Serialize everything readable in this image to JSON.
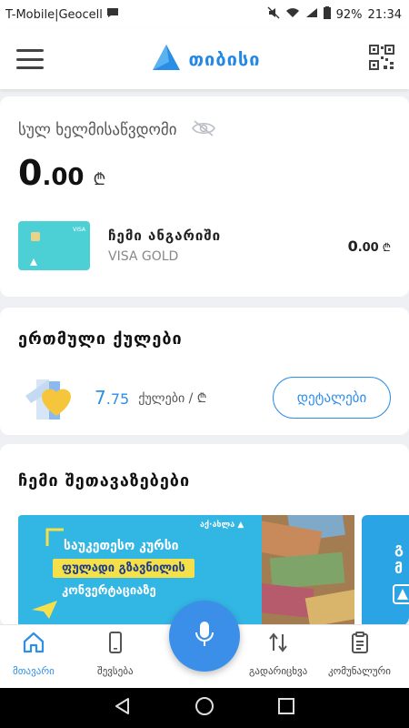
{
  "status_bar": {
    "carrier": "T-Mobile|Geocell",
    "battery": "92%",
    "time": "21:34"
  },
  "header": {
    "logo_text": "თიბისი"
  },
  "balance": {
    "label": "სულ ხელმისაწვდომი",
    "amount_int": "0",
    "amount_dec": ".00",
    "currency": "₾"
  },
  "account": {
    "card_brand": "VISA",
    "name": "ჩემი ანგარიში",
    "type": "VISA GOLD",
    "balance_int": "0",
    "balance_dec": ".00",
    "currency": "₾"
  },
  "points": {
    "title": "ერთმული ქულები",
    "value_int": "7",
    "value_dec": ".75",
    "unit": "ქულები / ₾",
    "details_label": "დეტალები"
  },
  "offers": {
    "title": "ჩემი შეთავაზებები",
    "promo_tag": "აქ·ახლა ▲",
    "promo_line1": "საუკეთესო კურსი",
    "promo_line2": "ფულადი გზავნილის",
    "promo_line3": "კონვერტაციაზე"
  },
  "bottom_nav": {
    "items": [
      {
        "label": "მთავარი",
        "icon": "home-icon",
        "active": true
      },
      {
        "label": "შევსება",
        "icon": "phone-icon",
        "active": false
      },
      {
        "label": "გადარიცხვა",
        "icon": "transfer-icon",
        "active": false
      },
      {
        "label": "კომუნალური",
        "icon": "clipboard-icon",
        "active": false
      }
    ]
  },
  "colors": {
    "accent": "#2e8fe8",
    "card": "#4dcfd6",
    "promo": "#32b6e4",
    "highlight": "#f6e04a"
  }
}
